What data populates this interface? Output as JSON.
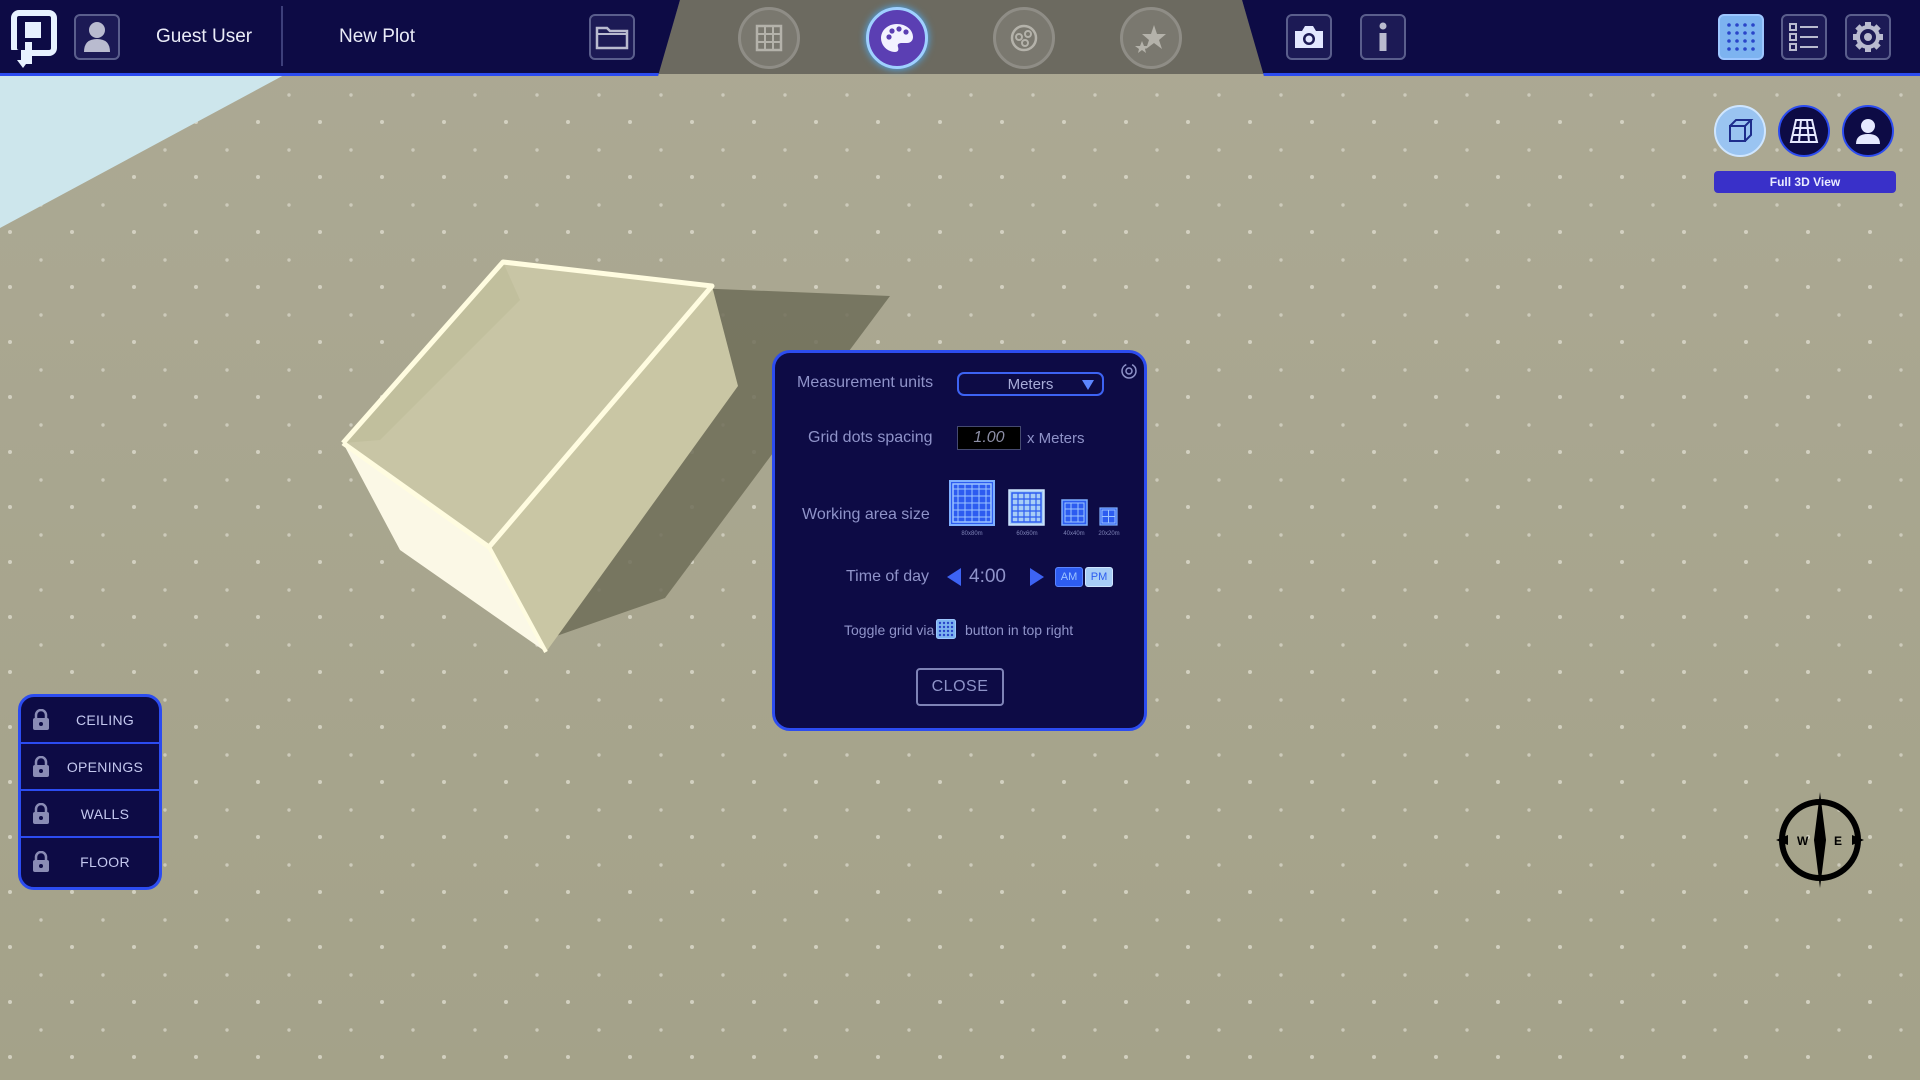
{
  "app": {
    "user_name": "Guest User",
    "plot_name": "New Plot"
  },
  "top_tools": {
    "active": "palette",
    "icons": [
      "grid-tool-icon",
      "palette-icon",
      "objects-icon",
      "favorites-icon"
    ]
  },
  "view": {
    "modes": [
      "full-3d",
      "top-down",
      "first-person"
    ],
    "active_mode": "full-3d",
    "label": "Full 3D View"
  },
  "locks": {
    "items": [
      {
        "label": "CEILING"
      },
      {
        "label": "OPENINGS"
      },
      {
        "label": "WALLS"
      },
      {
        "label": "FLOOR"
      }
    ]
  },
  "settings": {
    "measurement_label": "Measurement units",
    "measurement_value": "Meters",
    "grid_spacing_label": "Grid dots spacing",
    "grid_spacing_value": "1.00",
    "grid_spacing_unit": "x Meters",
    "working_area_label": "Working area size",
    "working_area_options": [
      "80x80m",
      "60x60m",
      "40x40m",
      "20x20m"
    ],
    "working_area_selected": "80x80m",
    "time_label": "Time of day",
    "time_value": "4:00",
    "am_label": "AM",
    "pm_label": "PM",
    "active_period": "PM",
    "hint_prefix": "Toggle grid via",
    "hint_suffix": "button in top right",
    "close_label": "CLOSE"
  },
  "compass": {
    "west": "W",
    "east": "E"
  },
  "colors": {
    "panel_bg": "#0d0b45",
    "accent_blue": "#2c4cf0",
    "active_light": "#9ac4f1",
    "ground": "#a6a48b",
    "sky": "#cde6ec"
  }
}
